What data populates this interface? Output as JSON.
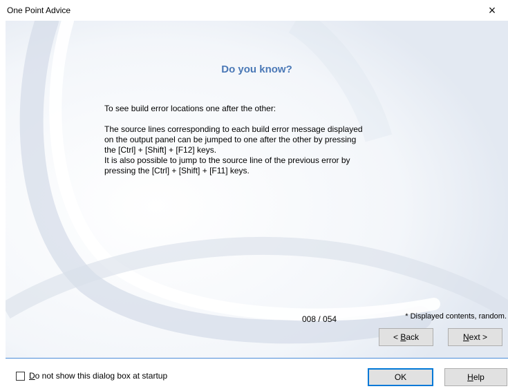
{
  "window": {
    "title": "One Point Advice",
    "close_icon": "×"
  },
  "advice": {
    "heading": "Do you know?",
    "intro": "To see build error locations one after the other:",
    "line1": "The source lines corresponding to each build error message displayed",
    "line2": "on the output panel can be jumped to one after the other by pressing",
    "line3": "the [Ctrl] + [Shift] + [F12] keys.",
    "line4": "It is also possible to  jump to the source line of the previous error by",
    "line5": "pressing the [Ctrl] + [Shift] + [F11] keys.",
    "random_note": "* Displayed contents, random."
  },
  "navigation": {
    "counter": "008 / 054",
    "back_prefix": "< ",
    "back_mnemonic": "B",
    "back_rest": "ack",
    "next_mnemonic": "N",
    "next_rest": "ext >"
  },
  "footer": {
    "checkbox_mnemonic": "D",
    "checkbox_rest": "o not show this dialog box at startup",
    "checkbox_checked": false,
    "ok_label": "OK",
    "help_mnemonic": "H",
    "help_rest": "elp"
  },
  "colors": {
    "heading": "#4a78b6",
    "separator": "#4a8cd8",
    "default_button_border": "#0078d7"
  }
}
